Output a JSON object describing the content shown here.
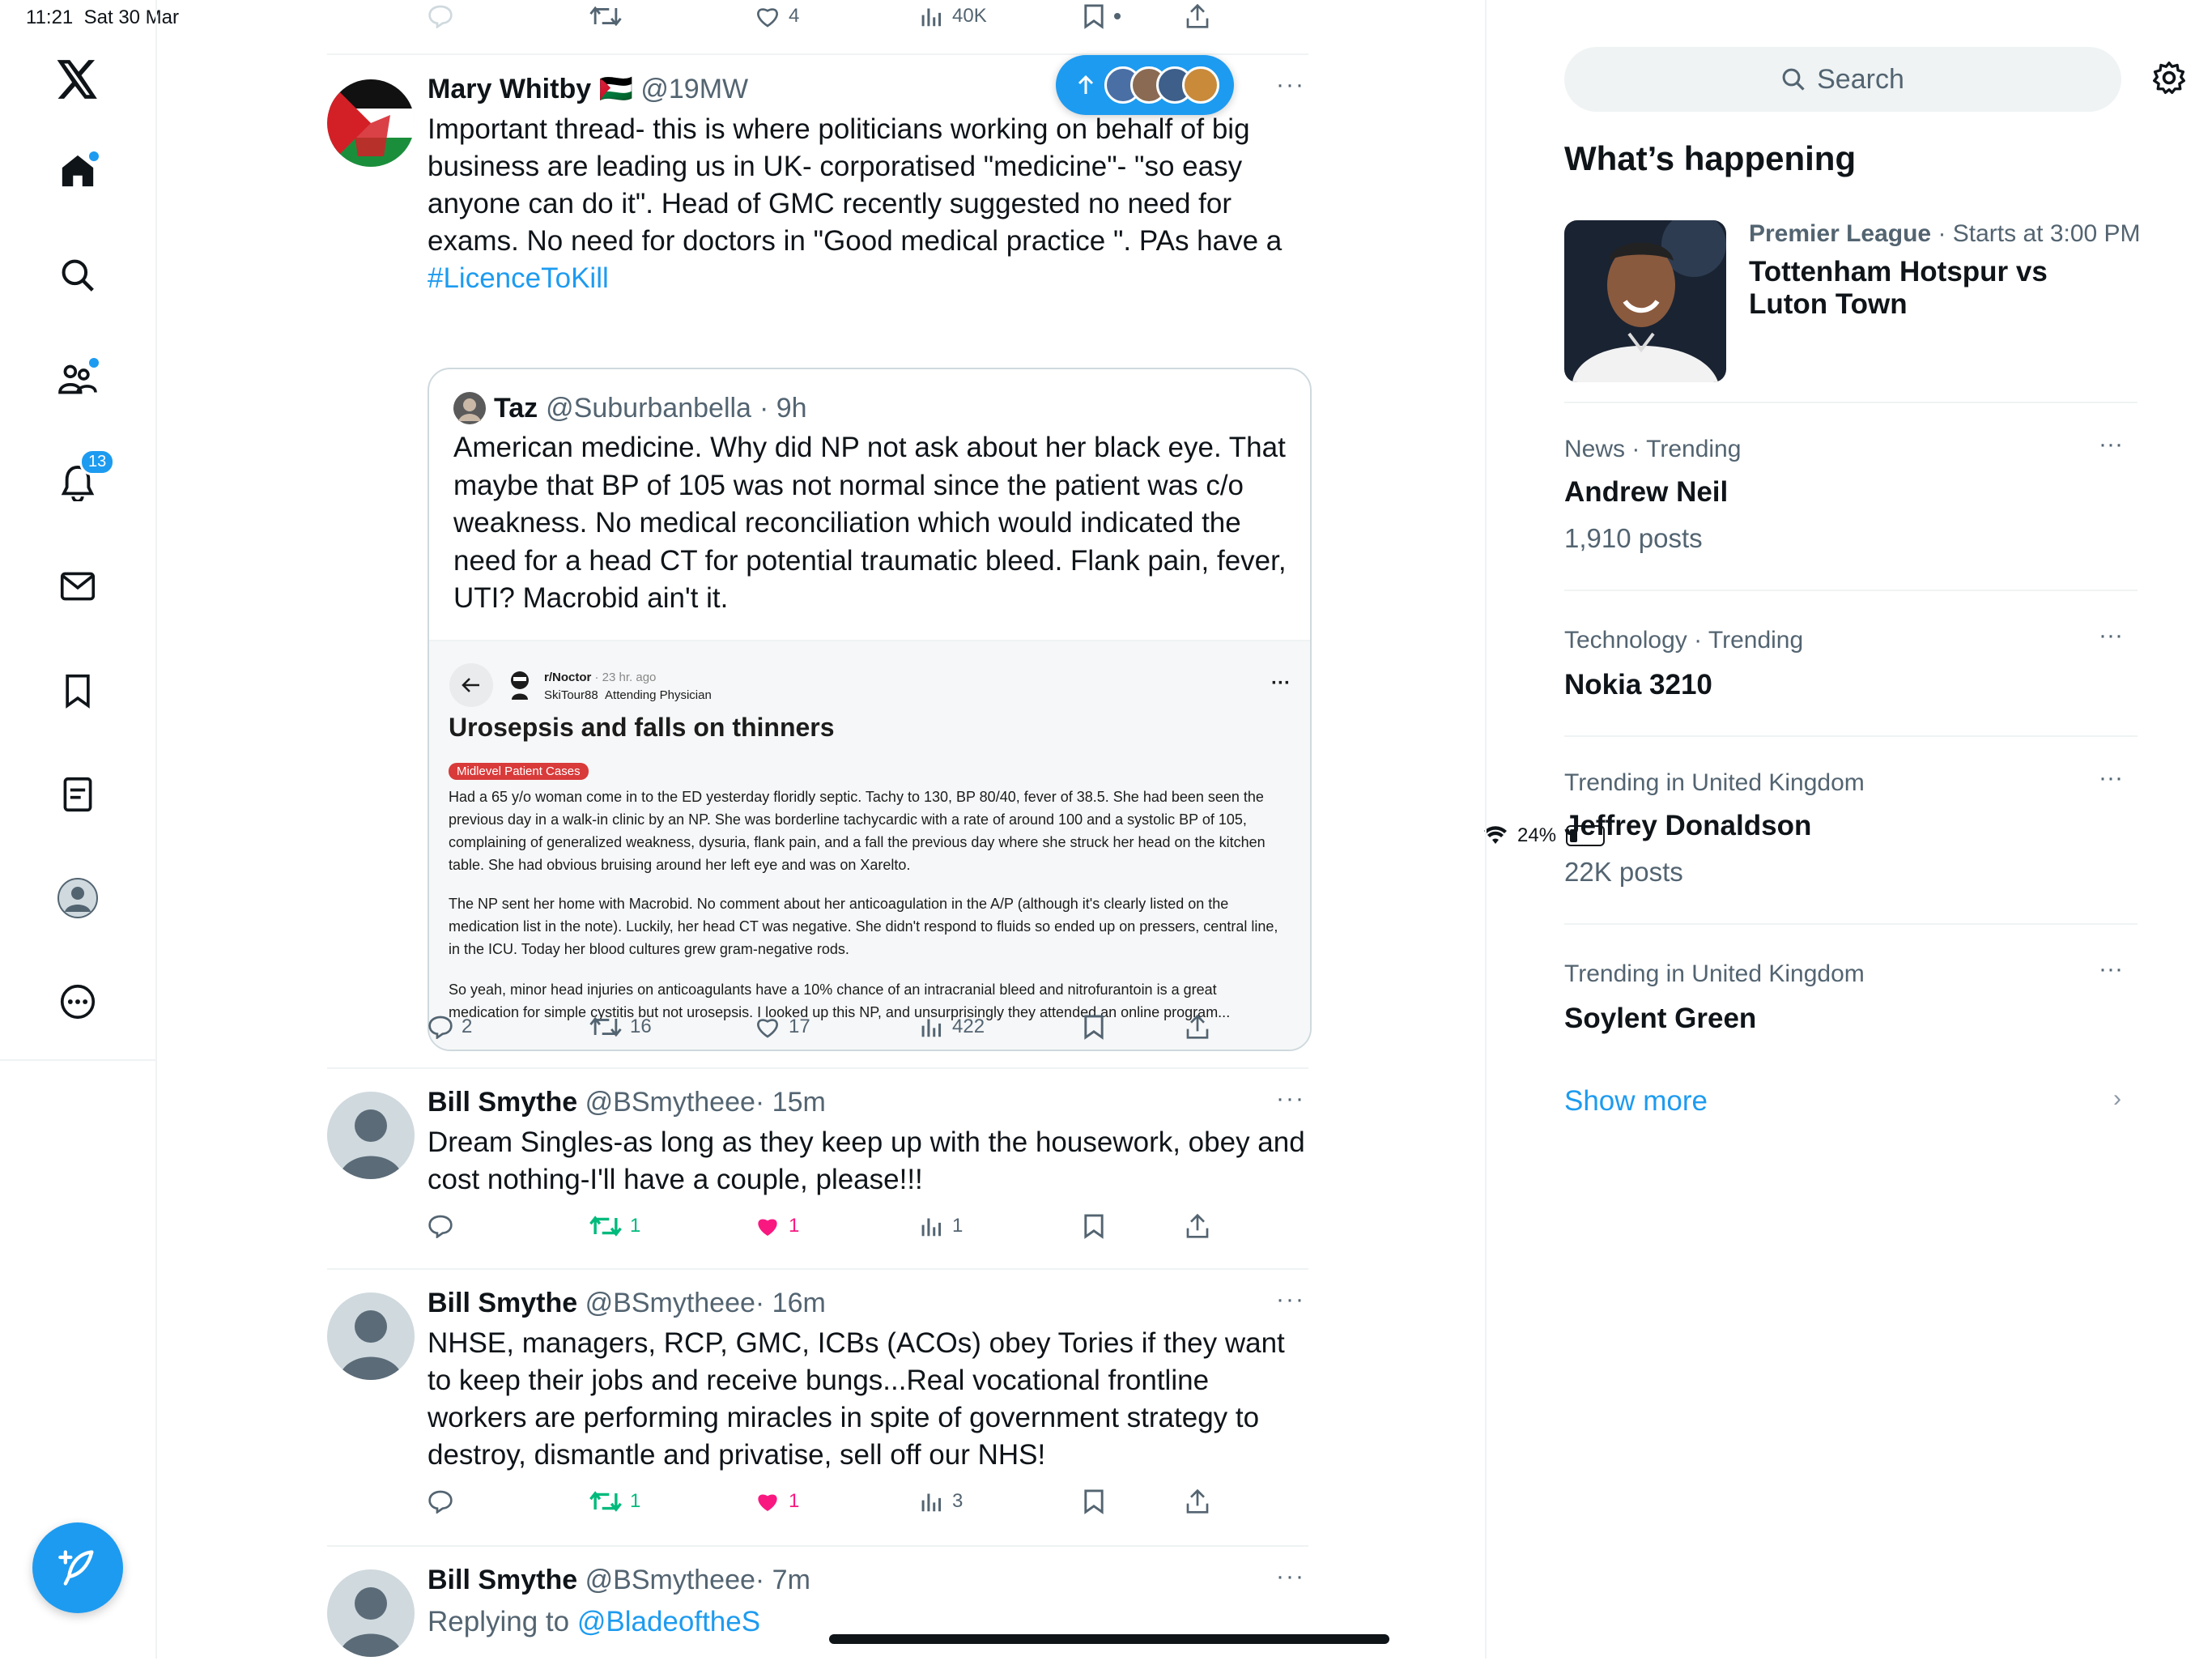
{
  "status": {
    "time": "11:21",
    "date": "Sat 30 Mar",
    "battery": "24%",
    "battery_level": 0.24
  },
  "nav": {
    "notifications_badge": "13",
    "items": [
      "x-logo",
      "home",
      "search",
      "communities",
      "notifications",
      "messages",
      "bookmarks",
      "lists",
      "profile",
      "more"
    ]
  },
  "timeline": {
    "prev_actions": {
      "likes": "4",
      "views": "40K"
    },
    "new_posts_pill": "new-posts",
    "tweet1": {
      "name": "Mary Whitby 🇵🇸",
      "handle": "@19MW",
      "text": "Important thread- this is where politicians working on behalf of big business are leading us in UK- corporatised \"medicine\"- \"so easy anyone can do it\". Head of GMC recently suggested no need for exams. No need for doctors in \"Good medical practice \". PAs have a",
      "hashtag": "#LicenceToKill",
      "quote": {
        "name": "Taz",
        "handle": "@Suburbanbella",
        "time": "· 9h",
        "text": "American medicine. Why did NP not ask about her black eye. That maybe that BP of 105 was not normal since the patient was c/o weakness. No medical reconciliation which would indicated the need for a head CT for potential traumatic bleed. Flank pain, fever, UTI? Macrobid ain't it.",
        "image": {
          "subreddit": "r/Noctor",
          "ago": "· 23 hr. ago",
          "user": "SkiTour88",
          "flair": "Attending Physician",
          "title": "Urosepsis and falls on thinners",
          "tag": "Midlevel Patient Cases",
          "p1": "Had a 65 y/o woman come in to the ED yesterday floridly septic. Tachy to 130, BP 80/40, fever of 38.5. She had been seen the previous day in a walk-in clinic by an NP. She was borderline tachycardic with a rate of around 100 and a systolic BP of 105, complaining of generalized weakness, dysuria, flank pain, and a fall the previous day where she struck her head on the kitchen table. She had obvious bruising around her left eye and was on Xarelto.",
          "p2": "The NP sent her home with Macrobid. No comment about her anticoagulation in the A/P (although it's clearly listed on the medication list in the note). Luckily, her head CT was negative. She didn't respond to fluids so ended up on pressers, central line, in the ICU. Today her blood cultures grew gram-negative rods.",
          "p3": "So yeah, minor head injuries on anticoagulants have a 10% chance of an intracranial bleed and nitrofurantoin is a great medication for simple cystitis but not urosepsis. I looked up this NP, and unsurprisingly they attended an online program..."
        }
      },
      "replies": "2",
      "retweets": "16",
      "likes": "17",
      "views": "422"
    },
    "tweet2": {
      "name": "Bill Smythe",
      "handle": "@BSmytheee",
      "time": "· 15m",
      "text": "Dream Singles-as long as they keep up with the housework, obey and cost nothing-I'll have a couple, please!!!",
      "retweets": "1",
      "likes": "1",
      "views": "1"
    },
    "tweet3": {
      "name": "Bill Smythe",
      "handle": "@BSmytheee",
      "time": "· 16m",
      "text": "NHSE, managers, RCP, GMC, ICBs (ACOs) obey Tories if they want to keep their jobs and receive bungs...Real vocational frontline workers are performing miracles in spite of government strategy to destroy, dismantle and privatise, sell off our NHS!",
      "retweets": "1",
      "likes": "1",
      "views": "3"
    },
    "tweet4": {
      "name": "Bill Smythe",
      "handle": "@BSmytheee",
      "time": "· 7m",
      "replying_prefix": "Replying to ",
      "replying_to": "@BladeoftheS"
    }
  },
  "sidebar": {
    "search_placeholder": "Search",
    "heading": "What’s happening",
    "event": {
      "category": "Premier League",
      "time": " · Starts at 3:00 PM",
      "title": "Tottenham Hotspur vs Luton Town"
    },
    "trends": [
      {
        "meta": "News · Trending",
        "title": "Andrew Neil",
        "posts": "1,910 posts"
      },
      {
        "meta": "Technology · Trending",
        "title": "Nokia 3210",
        "posts": ""
      },
      {
        "meta": "Trending in United Kingdom",
        "title": "Jeffrey Donaldson",
        "posts": "22K posts"
      },
      {
        "meta": "Trending in United Kingdom",
        "title": "Soylent Green",
        "posts": ""
      }
    ],
    "show_more": "Show more"
  },
  "colors": {
    "accent": "#1d9bf0",
    "like": "#f91880",
    "retweet": "#00ba7c",
    "text": "#0f1419",
    "muted": "#536471"
  }
}
